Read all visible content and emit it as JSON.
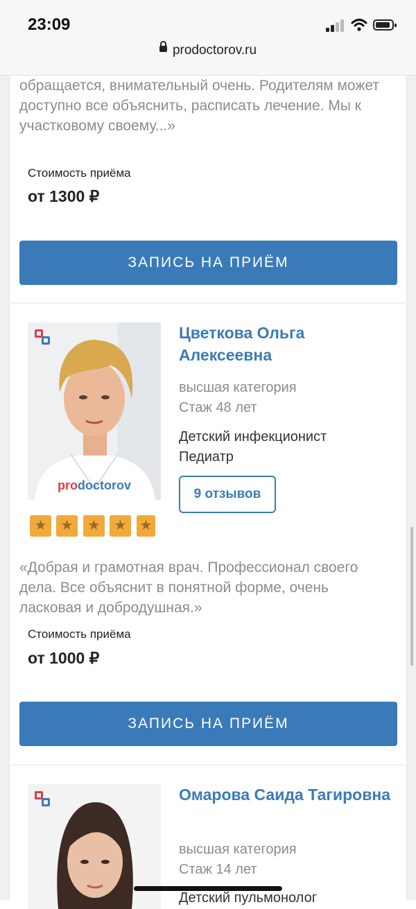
{
  "status_bar": {
    "time": "23:09"
  },
  "browser": {
    "url": "prodoctorov.ru"
  },
  "cards": [
    {
      "review_text": "всех детских болячках и с малышами хорошо обращается, внимательный очень. Родителям может доступно все объяснить, расписать лечение. Мы к участковому своему...»",
      "price_label": "Стоимость приёма",
      "price": "от 1300 ₽",
      "button_label": "ЗАПИСЬ НА ПРИЁМ"
    },
    {
      "name": "Цветкова Ольга Алексеевна",
      "category": "высшая категория",
      "experience": "Стаж 48 лет",
      "specialty_1": "Детский инфекционист",
      "specialty_2": "Педиатр",
      "reviews_label": "9 отзывов",
      "rating_stars": 4.8,
      "photo_watermark": "prodoctorov",
      "review_text": "«Добрая и грамотная врач. Профессионал своего дела. Все объяснит в понятной форме, очень ласковая и добродушная.»",
      "price_label": "Стоимость приёма",
      "price": "от 1000 ₽",
      "button_label": "ЗАПИСЬ НА ПРИЁМ"
    },
    {
      "name": "Омарова Саида Тагировна",
      "category": "высшая категория",
      "experience": "Стаж 14 лет",
      "specialty_1": "Детский пульмонолог"
    }
  ],
  "colors": {
    "accent": "#3a7ab9",
    "star": "#f2a93b",
    "muted_text": "#8c8c8c"
  },
  "icons": {
    "lock": "lock-icon",
    "wifi": "wifi-icon",
    "battery": "battery-icon",
    "signal": "signal-icon",
    "star": "star-icon"
  }
}
